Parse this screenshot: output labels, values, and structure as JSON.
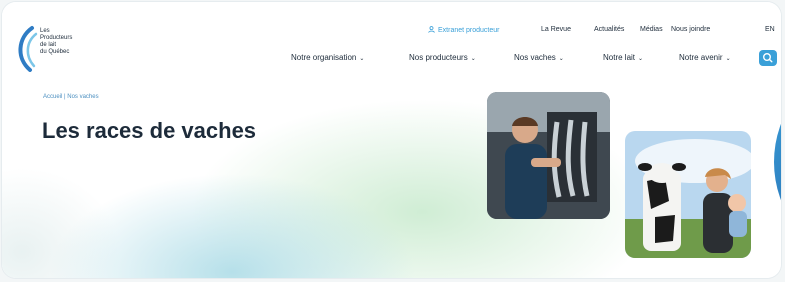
{
  "brand": {
    "name_lines": "Les\nProducteurs\nde lait\ndu Québec"
  },
  "utility_nav": {
    "extranet": "Extranet producteur",
    "revue": "La Revue",
    "actualites": "Actualités",
    "medias": "Médias",
    "nous_joindre": "Nous joindre",
    "lang": "EN"
  },
  "main_nav": [
    {
      "label": "Notre organisation"
    },
    {
      "label": "Nos producteurs"
    },
    {
      "label": "Nos vaches"
    },
    {
      "label": "Notre lait"
    },
    {
      "label": "Notre avenir"
    }
  ],
  "breadcrumb": "Accueil | Nos vaches",
  "page_title": "Les races de vaches",
  "icons": {
    "chevron": "chevron-down-icon",
    "user": "user-icon",
    "search": "search-icon"
  },
  "colors": {
    "accent": "#3aa0d8",
    "text": "#1d2b3a",
    "orb": "#1e6fc4"
  }
}
